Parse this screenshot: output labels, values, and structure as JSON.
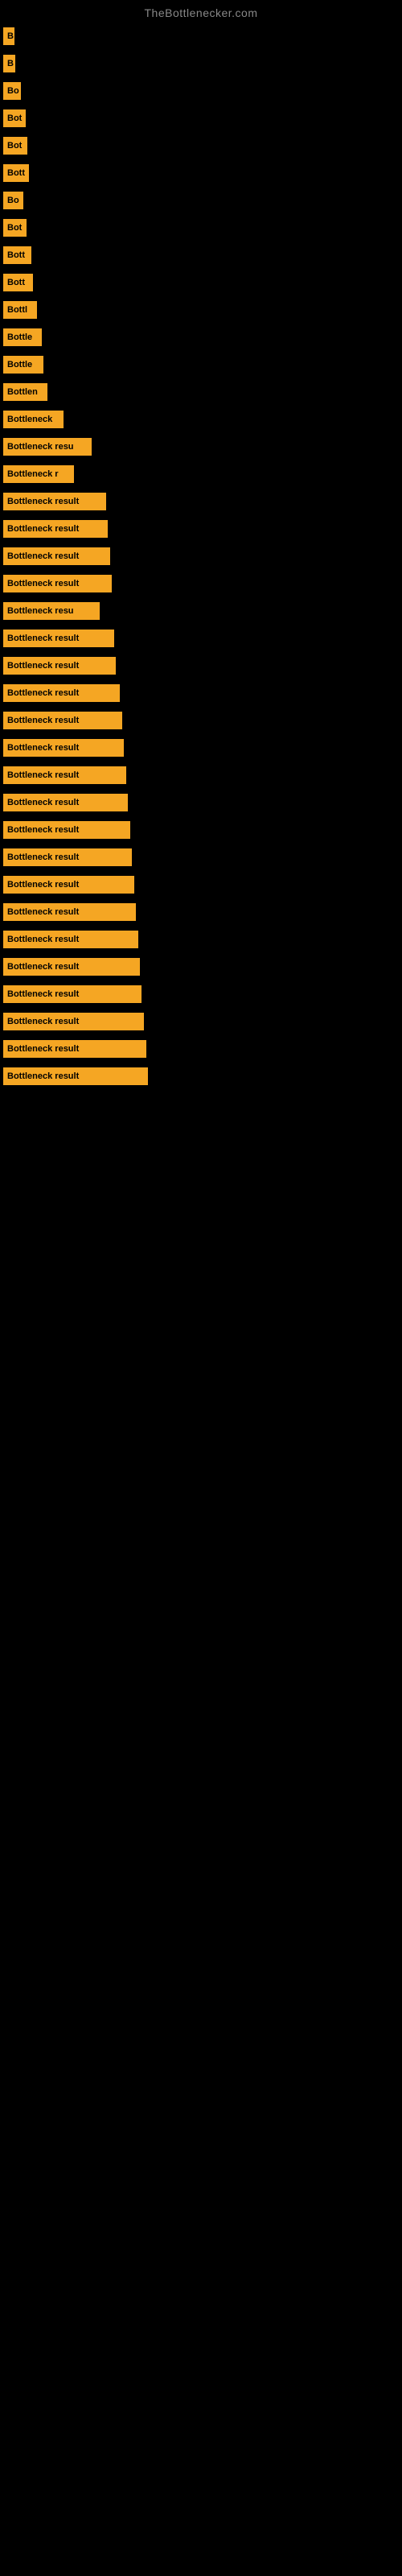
{
  "site": {
    "title": "TheBottlenecker.com"
  },
  "bars": [
    {
      "label": "B",
      "width": 14
    },
    {
      "label": "B",
      "width": 15
    },
    {
      "label": "Bo",
      "width": 22
    },
    {
      "label": "Bot",
      "width": 28
    },
    {
      "label": "Bot",
      "width": 30
    },
    {
      "label": "Bott",
      "width": 32
    },
    {
      "label": "Bo",
      "width": 25
    },
    {
      "label": "Bot",
      "width": 29
    },
    {
      "label": "Bott",
      "width": 35
    },
    {
      "label": "Bott",
      "width": 37
    },
    {
      "label": "Bottl",
      "width": 42
    },
    {
      "label": "Bottle",
      "width": 48
    },
    {
      "label": "Bottle",
      "width": 50
    },
    {
      "label": "Bottlen",
      "width": 55
    },
    {
      "label": "Bottleneck",
      "width": 75
    },
    {
      "label": "Bottleneck resu",
      "width": 110
    },
    {
      "label": "Bottleneck r",
      "width": 88
    },
    {
      "label": "Bottleneck result",
      "width": 128
    },
    {
      "label": "Bottleneck result",
      "width": 130
    },
    {
      "label": "Bottleneck result",
      "width": 133
    },
    {
      "label": "Bottleneck result",
      "width": 135
    },
    {
      "label": "Bottleneck resu",
      "width": 120
    },
    {
      "label": "Bottleneck result",
      "width": 138
    },
    {
      "label": "Bottleneck result",
      "width": 140
    },
    {
      "label": "Bottleneck result",
      "width": 145
    },
    {
      "label": "Bottleneck result",
      "width": 148
    },
    {
      "label": "Bottleneck result",
      "width": 150
    },
    {
      "label": "Bottleneck result",
      "width": 153
    },
    {
      "label": "Bottleneck result",
      "width": 155
    },
    {
      "label": "Bottleneck result",
      "width": 158
    },
    {
      "label": "Bottleneck result",
      "width": 160
    },
    {
      "label": "Bottleneck result",
      "width": 163
    },
    {
      "label": "Bottleneck result",
      "width": 165
    },
    {
      "label": "Bottleneck result",
      "width": 168
    },
    {
      "label": "Bottleneck result",
      "width": 170
    },
    {
      "label": "Bottleneck result",
      "width": 172
    },
    {
      "label": "Bottleneck result",
      "width": 175
    },
    {
      "label": "Bottleneck result",
      "width": 178
    },
    {
      "label": "Bottleneck result",
      "width": 180
    }
  ]
}
